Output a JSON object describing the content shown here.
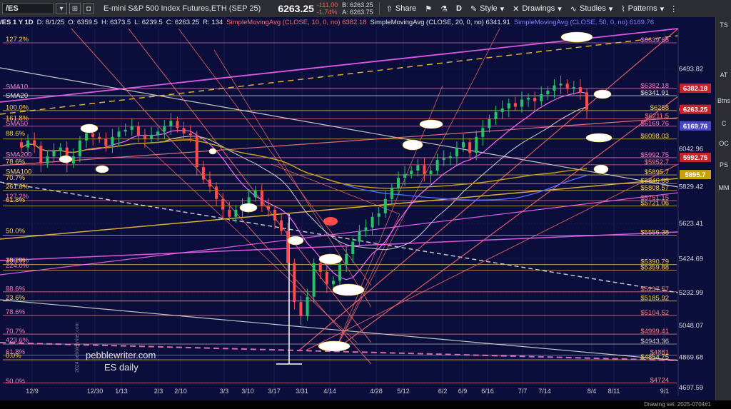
{
  "toolbar": {
    "symbol": "/ES",
    "description": "E-mini S&P 500 Index Futures,ETH (SEP 25)",
    "last_price": "6263.25",
    "change": "-111.00",
    "change_pct": "-1.74%",
    "bid": "B: 6263.25",
    "ask": "A: 6263.75",
    "share_label": "Share",
    "period_label": "D",
    "style_label": "Style",
    "drawings_label": "Drawings",
    "studies_label": "Studies",
    "patterns_label": "Patterns"
  },
  "subheader": {
    "symbol_period": "/ES 1 Y 1D",
    "date": "D: 8/1/25",
    "open": "O: 6359.5",
    "high": "H: 6373.5",
    "low": "L: 6239.5",
    "close": "C: 6263.25",
    "range": "R: 134",
    "sma10": "SimpleMovingAvg (CLOSE, 10, 0, no) 6382.18",
    "sma20": "SimpleMovingAvg (CLOSE, 20, 0, no) 6341.91",
    "sma50": "SimpleMovingAvg (CLOSE, 50, 0, no) 6169.76"
  },
  "watermark": {
    "line1": "pebblewriter.com",
    "line2": "ES daily",
    "vertical": "2024 pebblewriter.com"
  },
  "right_strip": [
    "TS",
    "AT",
    "Btns",
    "C",
    "OC",
    "PS",
    "MM"
  ],
  "footer": {
    "drawing_set": "Drawing set: 2025-0704#1"
  },
  "chart_data": {
    "type": "candlestick",
    "title": "",
    "xlabel": "",
    "ylabel": "",
    "ylim": [
      4650,
      6720
    ],
    "x_ticks": [
      "12/9",
      "12/30",
      "1/13",
      "2/3",
      "2/10",
      "3/3",
      "3/10",
      "3/17",
      "3/31",
      "4/14",
      "4/28",
      "5/12",
      "6/2",
      "6/9",
      "6/16",
      "7/7",
      "7/14",
      "8/4",
      "8/11",
      "9/1"
    ],
    "y_ticks": [
      6493.82,
      6262.96,
      6042.96,
      5829.42,
      5623.41,
      5424.69,
      5232.99,
      5048.07,
      4869.68,
      4697.59
    ],
    "price_badges": [
      {
        "label": "6382.18",
        "value": 6382.18,
        "color": "#c7222a"
      },
      {
        "label": "6263.25",
        "value": 6263.25,
        "color": "#c7222a"
      },
      {
        "label": "6169.76",
        "value": 6169.76,
        "color": "#4b46c8"
      },
      {
        "label": "5992.75",
        "value": 5992.75,
        "color": "#c7222a"
      },
      {
        "label": "5895.7",
        "value": 5895.7,
        "color": "#c9a20b"
      }
    ],
    "level_labels": [
      {
        "label": "$6639.68",
        "value": 6639.68,
        "color": "#ff79c6"
      },
      {
        "label": "$6382.18",
        "value": 6382.18,
        "color": "#ff79c6"
      },
      {
        "label": "$6341.91",
        "value": 6341.91,
        "color": "#e6e6e6"
      },
      {
        "label": "$6258",
        "value": 6258,
        "color": "#ffd24a"
      },
      {
        "label": "$6211.5",
        "value": 6211.5,
        "color": "#ff8080"
      },
      {
        "label": "$6169.76",
        "value": 6169.76,
        "color": "#ff79c6"
      },
      {
        "label": "$6098.03",
        "value": 6098.03,
        "color": "#ffd24a"
      },
      {
        "label": "$5992.75",
        "value": 5992.75,
        "color": "#ff79c6"
      },
      {
        "label": "$5952.7",
        "value": 5952.7,
        "color": "#ff8080"
      },
      {
        "label": "$5895.7",
        "value": 5895.7,
        "color": "#ffd24a"
      },
      {
        "label": "$5846.85",
        "value": 5846.85,
        "color": "#ffd24a"
      },
      {
        "label": "$5808.57",
        "value": 5808.57,
        "color": "#ffd24a"
      },
      {
        "label": "$5751.15",
        "value": 5751.15,
        "color": "#ff8080"
      },
      {
        "label": "$5721.06",
        "value": 5721.06,
        "color": "#ffd24a"
      },
      {
        "label": "$5556.38",
        "value": 5556.38,
        "color": "#ffd24a"
      },
      {
        "label": "$5390.79",
        "value": 5390.79,
        "color": "#ffd24a"
      },
      {
        "label": "$5359.88",
        "value": 5359.88,
        "color": "#ffd24a"
      },
      {
        "label": "$5237.57",
        "value": 5237.57,
        "color": "#ff8080"
      },
      {
        "label": "$5185.92",
        "value": 5185.92,
        "color": "#ffd24a"
      },
      {
        "label": "$5104.52",
        "value": 5104.52,
        "color": "#ff8080"
      },
      {
        "label": "$4999.41",
        "value": 4999.41,
        "color": "#ff8080"
      },
      {
        "label": "$4943.36",
        "value": 4943.36,
        "color": "#cccccc"
      },
      {
        "label": "$4881",
        "value": 4881,
        "color": "#ff8080"
      },
      {
        "label": "$4854.75",
        "value": 4854.75,
        "color": "#ffd24a"
      },
      {
        "label": "$4724",
        "value": 4724,
        "color": "#ff8080"
      }
    ],
    "left_labels": [
      {
        "label": "127.2%",
        "value": 6660,
        "color": "#ffd24a"
      },
      {
        "label": "SMA10",
        "value": 6392,
        "color": "#ff79c6"
      },
      {
        "label": "SMA20",
        "value": 6343,
        "color": "#e6e6e6"
      },
      {
        "label": "100.0%",
        "value": 6275,
        "color": "#ffd24a"
      },
      {
        "label": "161.8%",
        "value": 6216,
        "color": "#ffd24a"
      },
      {
        "label": "SMA50",
        "value": 6185,
        "color": "#ff79c6"
      },
      {
        "label": "88.6%",
        "value": 6130,
        "color": "#ffd24a"
      },
      {
        "label": "SMA200",
        "value": 6010,
        "color": "#ff79c6"
      },
      {
        "label": "78.6%",
        "value": 5970,
        "color": "#ffd24a"
      },
      {
        "label": "SMA100",
        "value": 5915,
        "color": "#ffd24a"
      },
      {
        "label": "70.7%",
        "value": 5880,
        "color": "#ffd24a"
      },
      {
        "label": "261.8%",
        "value": 5830,
        "color": "#ffd24a"
      },
      {
        "label": "127.2%",
        "value": 5775,
        "color": "#ff79c6"
      },
      {
        "label": "61.8%",
        "value": 5755,
        "color": "#ffd24a"
      },
      {
        "label": "50.0%",
        "value": 5580,
        "color": "#ffd24a"
      },
      {
        "label": "100.0%",
        "value": 5415,
        "color": "#ff79c6"
      },
      {
        "label": "38.2%",
        "value": 5415,
        "color": "#ffd24a"
      },
      {
        "label": "224.0%",
        "value": 5385,
        "color": "#ff79c6"
      },
      {
        "label": "88.6%",
        "value": 5255,
        "color": "#ff79c6"
      },
      {
        "label": "23.6%",
        "value": 5205,
        "color": "#ffd24a"
      },
      {
        "label": "78.6%",
        "value": 5125,
        "color": "#ff79c6"
      },
      {
        "label": "70.7%",
        "value": 5015,
        "color": "#ff79c6"
      },
      {
        "label": "423.6%",
        "value": 4965,
        "color": "#ff79c6"
      },
      {
        "label": "61.8%",
        "value": 4900,
        "color": "#ff79c6"
      },
      {
        "label": "0.0%",
        "value": 4880,
        "color": "#ffd24a"
      },
      {
        "label": "50.0%",
        "value": 4735,
        "color": "#ff79c6"
      }
    ],
    "candles_close_approx": [
      6050,
      6090,
      6060,
      5960,
      6000,
      6030,
      6050,
      5960,
      6000,
      6090,
      6130,
      6110,
      6100,
      6060,
      6110,
      6140,
      6150,
      6170,
      6120,
      6100,
      6120,
      6140,
      6170,
      6200,
      6160,
      6130,
      6120,
      5940,
      5870,
      5830,
      5760,
      5700,
      5660,
      5700,
      5730,
      5770,
      5810,
      5720,
      5700,
      5640,
      5580,
      5400,
      5180,
      5100,
      5210,
      5400,
      5350,
      5280,
      5300,
      5390,
      5450,
      5520,
      5580,
      5600,
      5660,
      5680,
      5760,
      5820,
      5880,
      5900,
      5920,
      5950,
      5900,
      5920,
      5980,
      5990,
      6000,
      6050,
      6080,
      6020,
      6110,
      6160,
      6210,
      6250,
      6270,
      6300,
      6280,
      6320,
      6330,
      6310,
      6350,
      6370,
      6400,
      6410,
      6380,
      6390,
      6360,
      6263
    ]
  }
}
